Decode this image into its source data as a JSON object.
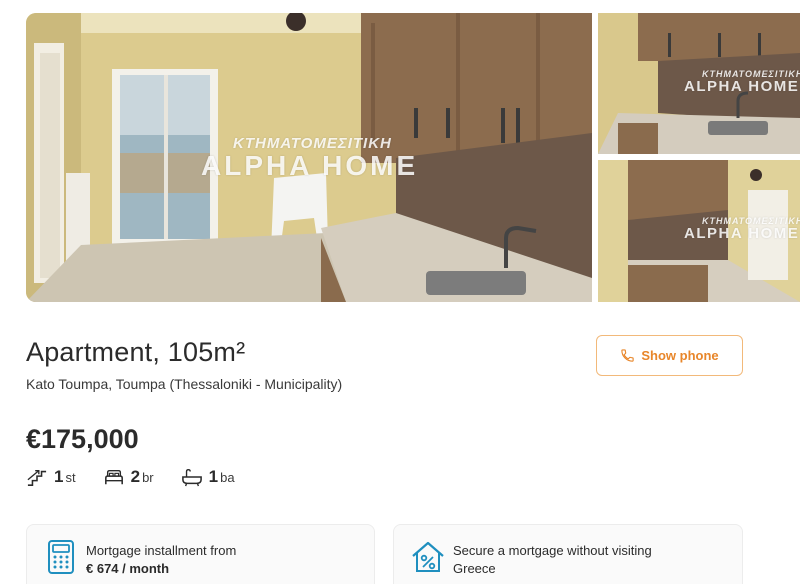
{
  "gallery": {
    "watermark_top": "ΚΤΗΜΑΤΟΜΕΣΙΤΙΚΗ",
    "watermark_bottom": "ALPHA HOME",
    "colors": {
      "wall": "#d9c88a",
      "cabinet": "#8a6a4c",
      "tile": "#6e5a4c",
      "counter": "#cfc7b8",
      "floor": "#c9c1b0"
    }
  },
  "listing": {
    "title": "Apartment, 105m²",
    "location": "Kato Toumpa, Toumpa (Thessaloniki - Municipality)",
    "price": "€175,000",
    "features": [
      {
        "icon": "stairs-icon",
        "value": "1",
        "unit": "st"
      },
      {
        "icon": "bed-icon",
        "value": "2",
        "unit": "br"
      },
      {
        "icon": "bathtub-icon",
        "value": "1",
        "unit": "ba"
      }
    ]
  },
  "actions": {
    "show_phone_label": "Show phone",
    "accent_color": "#e8862a"
  },
  "cards": {
    "mortgage": {
      "icon": "calculator-icon",
      "line1": "Mortgage installment from",
      "line2": "€ 674 / month"
    },
    "secure": {
      "icon": "home-percent-icon",
      "line1": "Secure a mortgage without visiting",
      "line2": "Greece"
    },
    "icon_color": "#1f8fbf"
  }
}
